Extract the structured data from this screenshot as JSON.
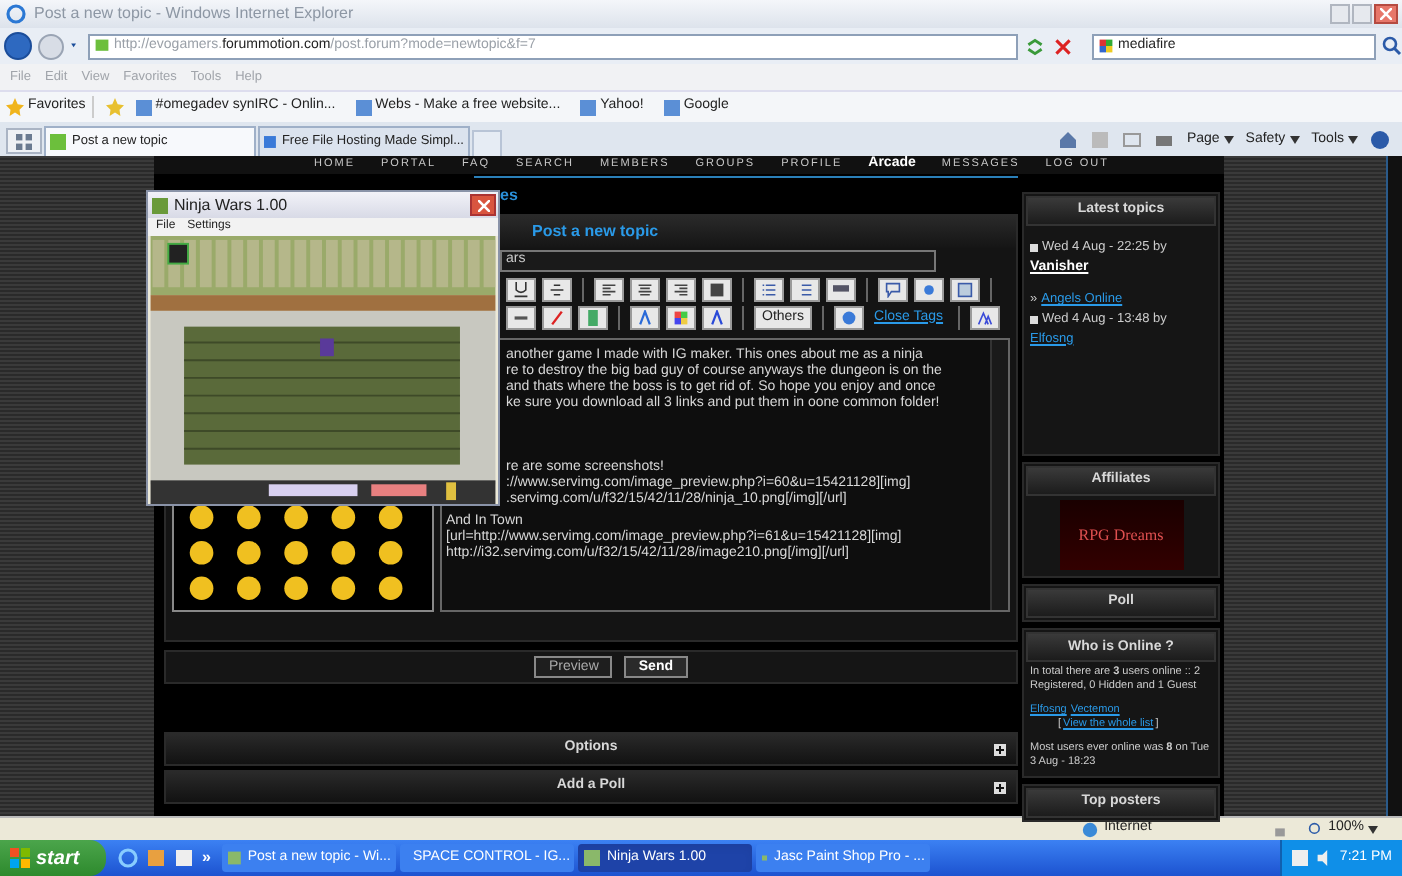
{
  "browser": {
    "title": "Post a new topic - Windows Internet Explorer",
    "address": "http://evogamers.**forummotion.com**/post.forum?mode=newtopic&f=7",
    "search": "mediafire",
    "menu": [
      "File",
      "Edit",
      "View",
      "Favorites",
      "Tools",
      "Help"
    ],
    "favorites_label": "Favorites",
    "favorites": [
      "#omegadev synIRC - Onlin...",
      "Webs - Make a free website...",
      "Yahoo!",
      "Google"
    ],
    "tabs": [
      {
        "label": "Post a new topic",
        "selected": true
      },
      {
        "label": "Free File Hosting Made Simpl...",
        "selected": false
      }
    ],
    "command_bar": [
      "Page",
      "Safety",
      "Tools"
    ]
  },
  "forum": {
    "nav": [
      {
        "label": "HOME",
        "selected": false
      },
      {
        "label": "PORTAL",
        "selected": false
      },
      {
        "label": "FAQ",
        "selected": false
      },
      {
        "label": "SEARCH",
        "selected": false
      },
      {
        "label": "MEMBERS",
        "selected": false
      },
      {
        "label": "GROUPS",
        "selected": false
      },
      {
        "label": "PROFILE",
        "selected": false
      },
      {
        "label": "Arcade",
        "selected": true
      },
      {
        "label": "MESSAGES",
        "selected": false
      },
      {
        "label": "LOG OUT",
        "selected": false
      }
    ],
    "breadcrumb": "es",
    "form": {
      "title": "Post a new topic",
      "subject": "ars",
      "others_button": "Others",
      "close_tags_link": "Close Tags",
      "paragraphs": [
        [
          "another game I made with IG maker. This ones about me as a ninja",
          "re to destroy the big bad guy of course anyways the dungeon is on the",
          "and thats where the boss is to get rid of. So hope you enjoy and once",
          "ke sure you download all 3 links and put them in oone common folder!"
        ],
        [
          "re are some screenshots!",
          "://www.servimg.com/image_preview.php?i=60&u=15421128][img]",
          ".servimg.com/u/f32/15/42/11/28/ninja_10.png[/img][/url]"
        ],
        [
          "And In Town",
          "[url=http://www.servimg.com/image_preview.php?i=61&u=15421128][img]",
          "http://i32.servimg.com/u/f32/15/42/11/28/image210.png[/img][/url]"
        ]
      ],
      "buttons": [
        {
          "label": "Preview",
          "primary": false
        },
        {
          "label": "Send",
          "primary": true
        }
      ]
    },
    "sections": [
      "Options",
      "Add a Poll"
    ]
  },
  "sidebar": {
    "latest_topics": {
      "title": "Latest topics",
      "items": [
        {
          "date": "Wed 4 Aug - 22:25 by",
          "author": "Vanisher"
        },
        {
          "marker": "»",
          "topic": "Angels Online",
          "date": "Wed 4 Aug - 13:48 by",
          "author": "Elfosng"
        }
      ]
    },
    "affiliates": {
      "title": "Affiliates",
      "banner": "RPG Dreams"
    },
    "poll": {
      "title": "Poll"
    },
    "online": {
      "title": "Who is Online ?",
      "summary": "In total there are **3** users online :: 2 Registered, 0 Hidden and 1 Guest",
      "users": [
        "Elfosng",
        "Vectemon"
      ],
      "view_list_open": "[",
      "view_list": "View the whole list",
      "view_list_close": "]",
      "record": "Most users ever online was **8** on Tue 3 Aug - 18:23"
    },
    "top_posters": {
      "title": "Top posters"
    }
  },
  "game_window": {
    "title": "Ninja Wars 1.00",
    "menu": [
      "File",
      "Settings"
    ]
  },
  "status_bar": {
    "zone": "Internet",
    "zoom": "100%"
  },
  "taskbar": {
    "start": "start",
    "more": "»",
    "tasks": [
      {
        "label": "Post a new topic - Wi...",
        "selected": false
      },
      {
        "label": "SPACE CONTROL - IG...",
        "selected": false
      },
      {
        "label": "Ninja Wars 1.00",
        "selected": true
      },
      {
        "label": "Jasc Paint Shop Pro - ...",
        "selected": false
      }
    ],
    "clock": "7:21 PM"
  }
}
